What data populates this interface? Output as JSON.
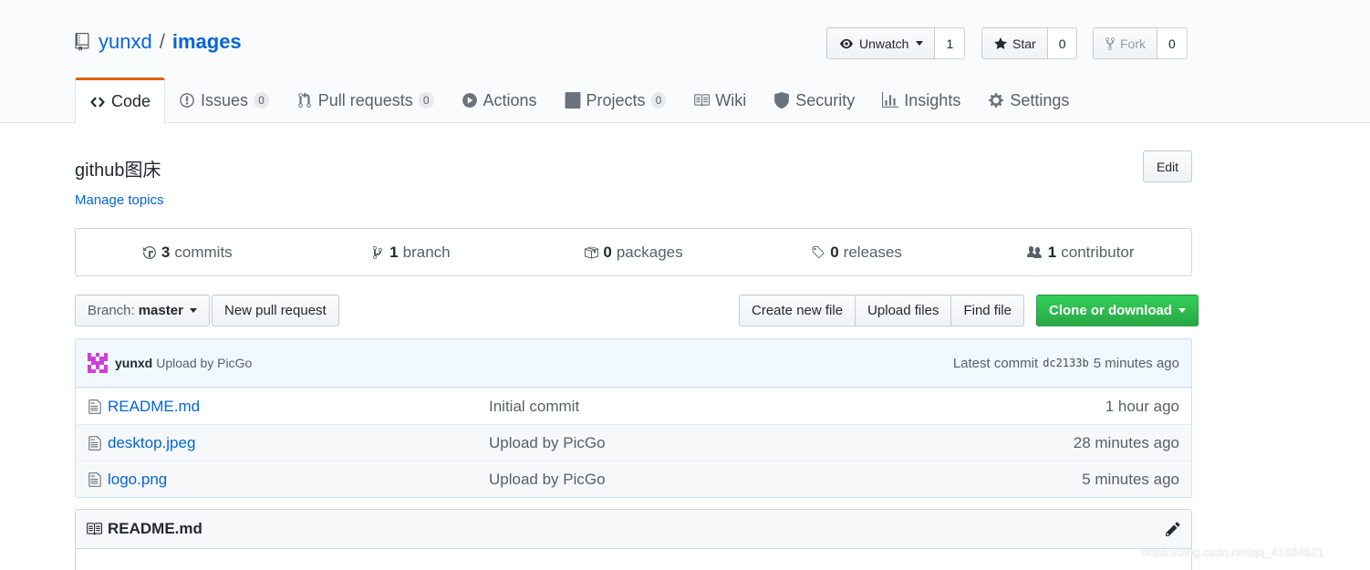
{
  "repo": {
    "owner": "yunxd",
    "sep": "/",
    "name": "images"
  },
  "actions": {
    "watch_label": "Unwatch",
    "watch_count": "1",
    "star_label": "Star",
    "star_count": "0",
    "fork_label": "Fork",
    "fork_count": "0"
  },
  "tabs": [
    {
      "label": "Code",
      "icon": "code-icon"
    },
    {
      "label": "Issues",
      "count": "0",
      "icon": "issue-icon"
    },
    {
      "label": "Pull requests",
      "count": "0",
      "icon": "pull-request-icon"
    },
    {
      "label": "Actions",
      "icon": "play-icon"
    },
    {
      "label": "Projects",
      "count": "0",
      "icon": "project-icon"
    },
    {
      "label": "Wiki",
      "icon": "book-icon"
    },
    {
      "label": "Security",
      "icon": "shield-icon"
    },
    {
      "label": "Insights",
      "icon": "graph-icon"
    },
    {
      "label": "Settings",
      "icon": "gear-icon"
    }
  ],
  "description": "github图床",
  "manage_topics": "Manage topics",
  "edit_label": "Edit",
  "summary": [
    {
      "num": "3",
      "label": "commits",
      "icon": "history-icon"
    },
    {
      "num": "1",
      "label": "branch",
      "icon": "branch-icon"
    },
    {
      "num": "0",
      "label": "packages",
      "icon": "package-icon"
    },
    {
      "num": "0",
      "label": "releases",
      "icon": "tag-icon"
    },
    {
      "num": "1",
      "label": "contributor",
      "icon": "people-icon"
    }
  ],
  "file_nav": {
    "branch_prefix": "Branch:",
    "branch_name": "master",
    "new_pr": "New pull request",
    "create_file": "Create new file",
    "upload_files": "Upload files",
    "find_file": "Find file",
    "clone": "Clone or download"
  },
  "commit": {
    "author": "yunxd",
    "message": "Upload by PicGo",
    "latest_label": "Latest commit",
    "sha": "dc2133b",
    "age": "5 minutes ago"
  },
  "files": [
    {
      "name": "README.md",
      "message": "Initial commit",
      "age": "1 hour ago"
    },
    {
      "name": "desktop.jpeg",
      "message": "Upload by PicGo",
      "age": "28 minutes ago"
    },
    {
      "name": "logo.png",
      "message": "Upload by PicGo",
      "age": "5 minutes ago"
    }
  ],
  "readme": {
    "title": "README.md"
  },
  "watermark": "https://blog.csdn.net/qq_41684621",
  "colors": {
    "accent_tab": "#e36209",
    "link": "#0366d6",
    "green": "#28a745",
    "avatar": "#d03fd9"
  }
}
